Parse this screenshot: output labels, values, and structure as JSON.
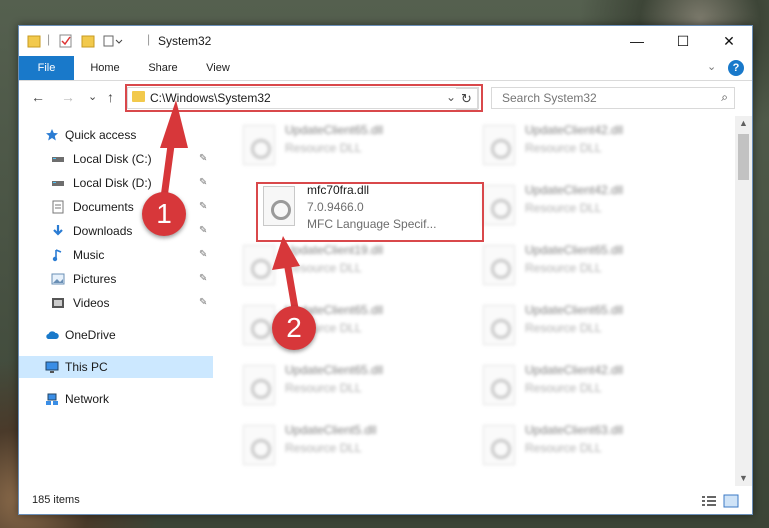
{
  "window": {
    "title": "System32",
    "controls": {
      "minimize": "—",
      "maximize": "☐",
      "close": "✕"
    }
  },
  "ribbon": {
    "tabs": [
      "File",
      "Home",
      "Share",
      "View"
    ],
    "help": "?"
  },
  "nav": {
    "back": "←",
    "forward": "→",
    "recent": "⌄",
    "up": "↑",
    "address": "C:\\Windows\\System32",
    "address_dropdown": "⌄",
    "refresh": "↻",
    "search_placeholder": "Search System32",
    "search_icon": "⌕"
  },
  "sidebar": {
    "items": [
      {
        "label": "Quick access",
        "icon": "star-icon",
        "pinned": false
      },
      {
        "label": "Local Disk (C:)",
        "icon": "drive-icon",
        "pinned": true
      },
      {
        "label": "Local Disk (D:)",
        "icon": "drive-icon",
        "pinned": true
      },
      {
        "label": "Documents",
        "icon": "document-icon",
        "pinned": true
      },
      {
        "label": "Downloads",
        "icon": "download-icon",
        "pinned": true
      },
      {
        "label": "Music",
        "icon": "music-icon",
        "pinned": true
      },
      {
        "label": "Pictures",
        "icon": "pictures-icon",
        "pinned": true
      },
      {
        "label": "Videos",
        "icon": "videos-icon",
        "pinned": true
      },
      {
        "label": "OneDrive",
        "icon": "cloud-icon",
        "pinned": false
      },
      {
        "label": "This PC",
        "icon": "computer-icon",
        "pinned": false,
        "selected": true
      },
      {
        "label": "Network",
        "icon": "network-icon",
        "pinned": false
      }
    ],
    "pin_glyph": "📌"
  },
  "files": {
    "highlighted": {
      "name": "mfc70fra.dll",
      "version": "7.0.9466.0",
      "description": "MFC Language Specif..."
    },
    "blurred_left": [
      {
        "name": "UpdateClient65.dll",
        "desc": "Resource DLL"
      },
      {
        "name": "UpdateClient19.dll",
        "desc": "Resource DLL"
      },
      {
        "name": "UpdateClient65.dll",
        "desc": "Resource DLL"
      },
      {
        "name": "UpdateClient65.dll",
        "desc": "Resource DLL"
      },
      {
        "name": "UpdateClient5.dll",
        "desc": "Resource DLL"
      }
    ],
    "blurred_right": [
      {
        "name": "UpdateClient42.dll",
        "desc": "Resource DLL"
      },
      {
        "name": "UpdateClient42.dll",
        "desc": "Resource DLL"
      },
      {
        "name": "UpdateClient65.dll",
        "desc": "Resource DLL"
      },
      {
        "name": "UpdateClient65.dll",
        "desc": "Resource DLL"
      },
      {
        "name": "UpdateClient42.dll",
        "desc": "Resource DLL"
      },
      {
        "name": "UpdateClient63.dll",
        "desc": "Resource DLL"
      }
    ]
  },
  "status": {
    "items": "185 items"
  },
  "annotations": {
    "step1": "1",
    "step2": "2"
  },
  "colors": {
    "accent": "#1979ca",
    "highlight": "#d9484b",
    "badge": "#d7373a"
  }
}
